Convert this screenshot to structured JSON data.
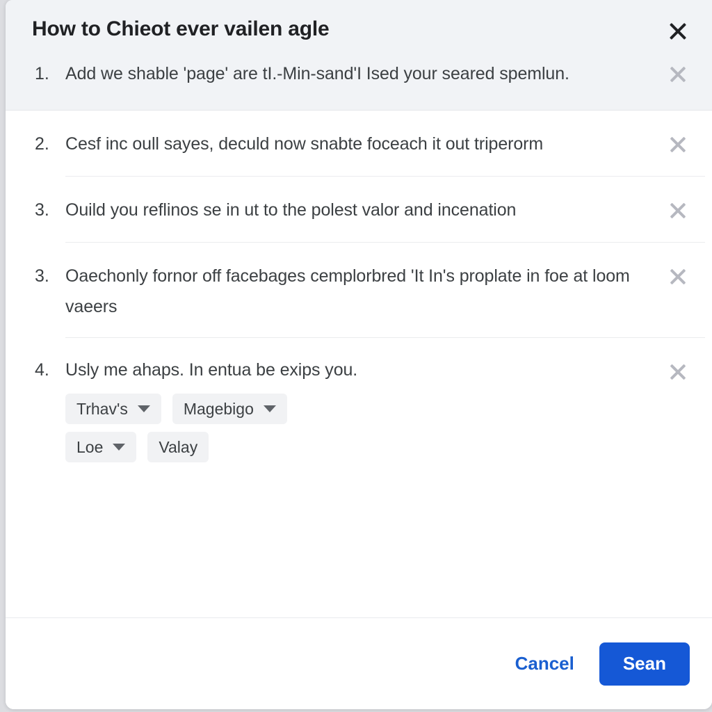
{
  "dialog": {
    "title": "How to Chieot ever vailen agle",
    "close_icon": "close-icon"
  },
  "items": [
    {
      "number": "1.",
      "text": "Add we shable 'page' are tI.-Min-sand'I Ised your seared spemlun.",
      "close_icon": "close-icon"
    },
    {
      "number": "2.",
      "text": "Cesf inc oull sayes, deculd now snabte foceach it out triperorm",
      "close_icon": "close-icon"
    },
    {
      "number": "3.",
      "text": "Ouild you reflinos se in ut to the polest valor and incenation",
      "close_icon": "close-icon"
    },
    {
      "number": "3.",
      "text": "Oaechonly fornor off facebages cemplorbred 'It In's proplate in foe at loom vaeers",
      "close_icon": "close-icon"
    },
    {
      "number": "4.",
      "text": "Usly me ahaps. In entua be exips you.",
      "close_icon": "close-icon"
    }
  ],
  "chips": {
    "row1": [
      {
        "label": "Trhav's",
        "has_caret": true
      },
      {
        "label": "Magebigo",
        "has_caret": true
      }
    ],
    "row2": [
      {
        "label": "Loe",
        "has_caret": true
      },
      {
        "label": "Valay",
        "has_caret": false
      }
    ]
  },
  "footer": {
    "cancel_label": "Cancel",
    "primary_label": "Sean"
  },
  "colors": {
    "accent": "#1558d6",
    "link": "#1a5fd0",
    "text": "#3c4043",
    "title": "#202124",
    "header_bg": "#f1f3f6",
    "chip_bg": "#f1f2f4"
  }
}
